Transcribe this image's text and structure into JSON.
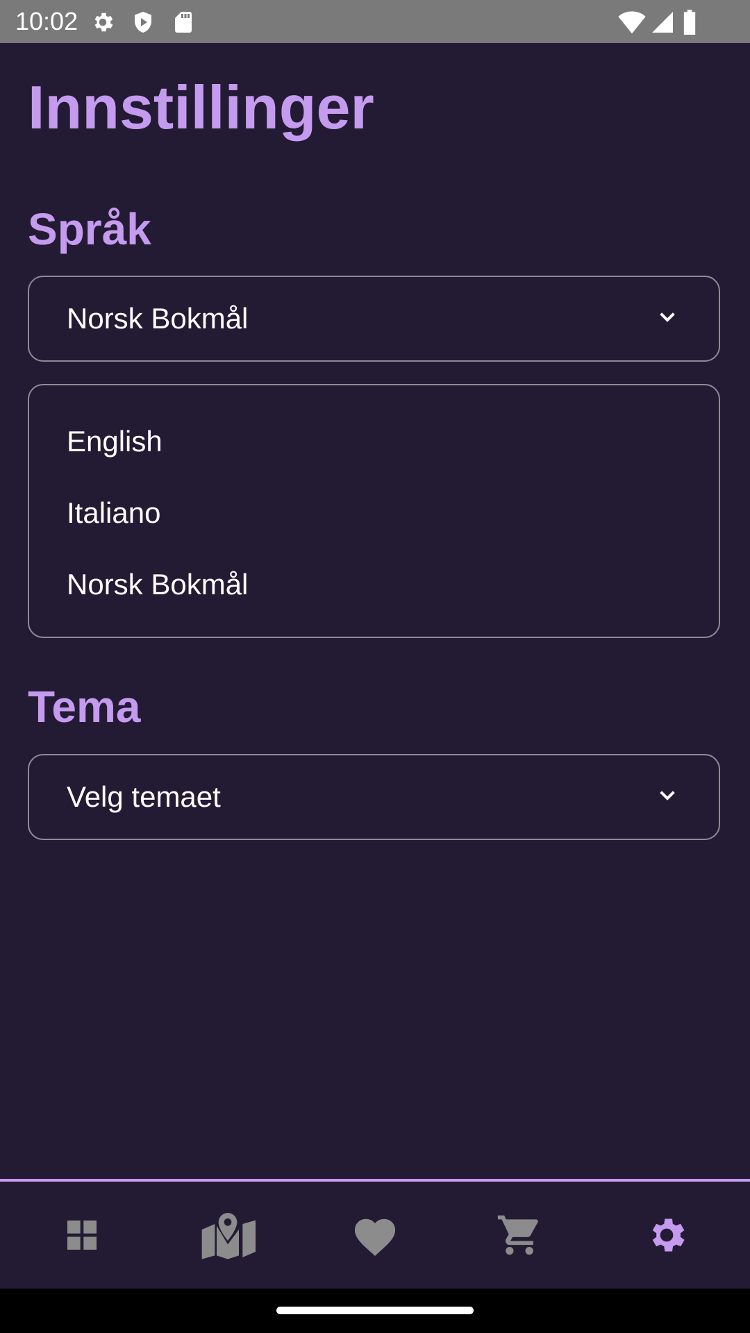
{
  "status_bar": {
    "time": "10:02",
    "icons_left": [
      "gear-icon",
      "shield-icon",
      "sd-card-icon"
    ],
    "icons_right": [
      "wifi-icon",
      "signal-icon",
      "battery-icon"
    ]
  },
  "page": {
    "title": "Innstillinger"
  },
  "language": {
    "section_title": "Språk",
    "selected": "Norsk Bokmål",
    "options": [
      "English",
      "Italiano",
      "Norsk Bokmål"
    ]
  },
  "theme": {
    "section_title": "Tema",
    "placeholder": "Velg temaet"
  },
  "bottom_nav": {
    "items": [
      {
        "icon": "dashboard-icon",
        "active": false
      },
      {
        "icon": "map-icon",
        "active": false
      },
      {
        "icon": "heart-icon",
        "active": false
      },
      {
        "icon": "cart-icon",
        "active": false
      },
      {
        "icon": "settings-icon",
        "active": true
      }
    ],
    "active_color": "#c59bef",
    "inactive_color": "#8c8c8c"
  },
  "colors": {
    "background": "#231b33",
    "accent": "#c59bef",
    "text": "#ffffff",
    "border": "#8f8a96"
  }
}
